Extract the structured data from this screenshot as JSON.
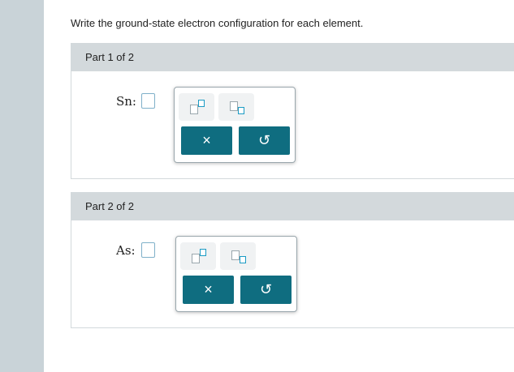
{
  "instruction": "Write the ground-state electron configuration for each element.",
  "parts": [
    {
      "header": "Part 1 of 2",
      "element_label": "Sn:",
      "answer_value": "",
      "palette": {
        "superscript_icon": "superscript-template-icon",
        "subscript_icon": "subscript-template-icon",
        "clear_symbol": "×",
        "undo_symbol": "↺"
      }
    },
    {
      "header": "Part 2 of 2",
      "element_label": "As:",
      "answer_value": "",
      "palette": {
        "superscript_icon": "superscript-template-icon",
        "subscript_icon": "subscript-template-icon",
        "clear_symbol": "×",
        "undo_symbol": "↺"
      }
    }
  ],
  "colors": {
    "left_rail": "#c9d3d8",
    "part_header_bg": "#d3d9dc",
    "action_button": "#0f6d80",
    "template_accent": "#1b9bc4"
  }
}
